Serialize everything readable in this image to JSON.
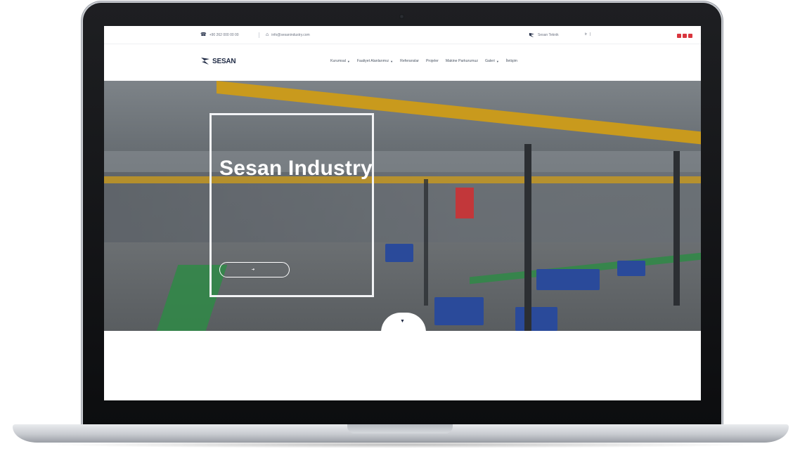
{
  "topbar": {
    "phone": "+90 262 000 00 00",
    "email": "info@sesanindustry.com",
    "brand_link": "Sesan Teknik",
    "lang": "tr",
    "lang_sep": "|"
  },
  "logo": {
    "text": "SESAN"
  },
  "nav": {
    "items": [
      {
        "label": "Kurumsal",
        "dropdown": true
      },
      {
        "label": "Faaliyet Alanlarımız",
        "dropdown": true
      },
      {
        "label": "Referanslar",
        "dropdown": false
      },
      {
        "label": "Projeler",
        "dropdown": false
      },
      {
        "label": "Makine Parkurumuz",
        "dropdown": false
      },
      {
        "label": "Galeri",
        "dropdown": true
      },
      {
        "label": "İletişim",
        "dropdown": false
      }
    ]
  },
  "hero": {
    "title": "Sesan Industry",
    "description": "",
    "button_label": ""
  },
  "colors": {
    "brand_dark": "#1f2a44",
    "accent_red": "#d9363e",
    "beam_yellow": "#c99a1d",
    "floor_green": "#2f8a47",
    "machine_blue": "#2a4a9a"
  }
}
